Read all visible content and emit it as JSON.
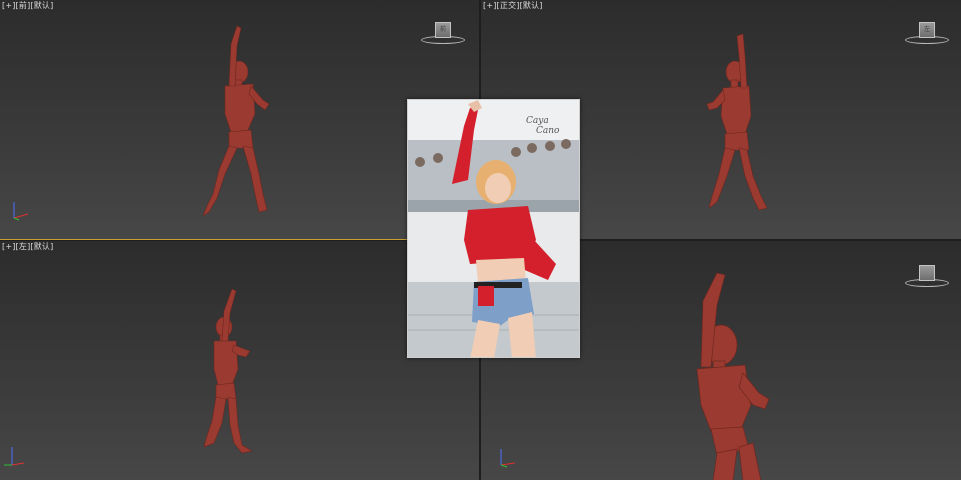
{
  "viewports": {
    "top_left": {
      "label": "[+][前][默认]",
      "viewcube_face": "前"
    },
    "top_right": {
      "label": "[+][正交][默认]",
      "viewcube_face": "左"
    },
    "bottom_left": {
      "label": "[+][左][默认]",
      "viewcube_face": ""
    },
    "bottom_right": {
      "label": "",
      "viewcube_face": ""
    }
  },
  "colors": {
    "mannequin": "#9b3a30",
    "active_border": "#c8a032",
    "background_top": "#2c2c2c",
    "background_bottom": "#474747"
  },
  "icons": [
    "viewcube-icon",
    "axis-gizmo-icon"
  ],
  "reference_photo": {
    "watermark_line1": "Caya",
    "watermark_line2": "Cano"
  }
}
